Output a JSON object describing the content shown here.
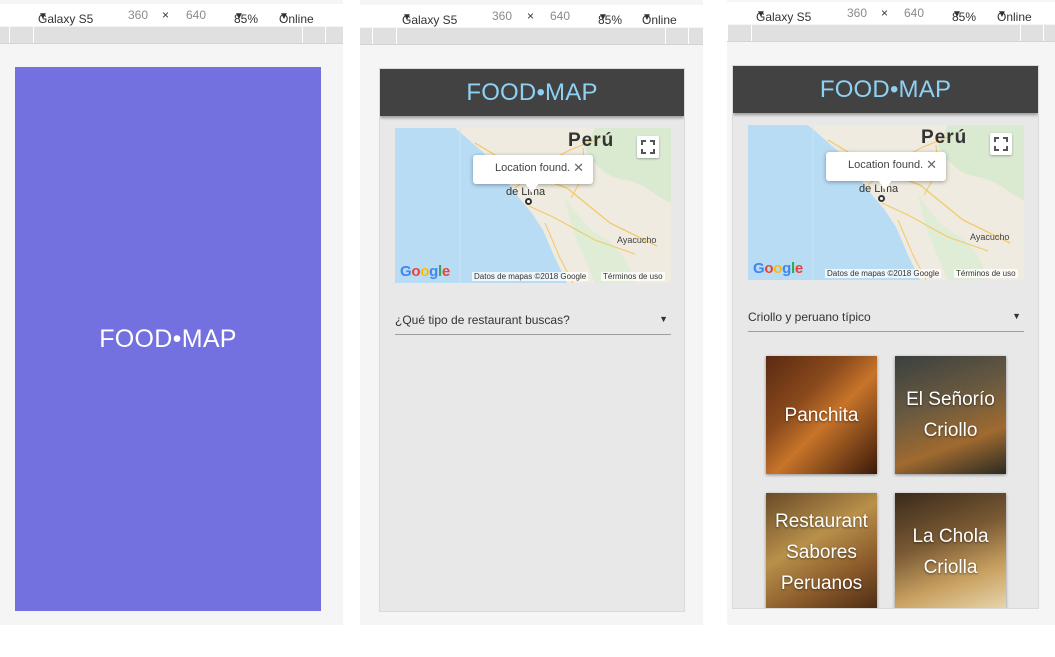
{
  "devtools": {
    "device": "Galaxy S5",
    "width": "360",
    "times": "×",
    "height": "640",
    "zoom": "85%",
    "network": "Online",
    "dropdown_glyph": "▼"
  },
  "app": {
    "brand": "FOOD•MAP"
  },
  "map": {
    "country_label": "Perú",
    "city_label": "Ayacucho",
    "lima_label": "de Lima",
    "popup_text": "Location found.",
    "popup_close": "✕",
    "logo_letters": [
      "G",
      "o",
      "o",
      "g",
      "l",
      "e"
    ],
    "logo_colors": [
      "#4285F4",
      "#EA4335",
      "#FBBC05",
      "#4285F4",
      "#34A853",
      "#EA4335"
    ],
    "attribution": "Datos de mapas ©2018 Google",
    "terms": "Términos de uso"
  },
  "screen2": {
    "select_placeholder": "¿Qué tipo de restaurant buscas?",
    "select_arrow": "▼"
  },
  "screen3": {
    "select_value": "Criollo y peruano típico",
    "select_arrow": "▼",
    "restaurants": [
      {
        "name": "Panchita"
      },
      {
        "name": "El Señorío Criollo"
      },
      {
        "name": "Restaurant Sabores Peruanos"
      },
      {
        "name": "La Chola Criolla"
      }
    ]
  },
  "colors": {
    "splash_bg": "#7370E0",
    "topbar_bg": "#424242",
    "brand_text": "#8FD1F3",
    "screen_bg": "#E8E8E8",
    "map_water": "#B7DCF4",
    "map_land": "#EFEBE0"
  },
  "icons": [
    "dropdown-arrow-icon",
    "fullscreen-icon",
    "close-icon",
    "map-pin-icon",
    "google-logo"
  ]
}
